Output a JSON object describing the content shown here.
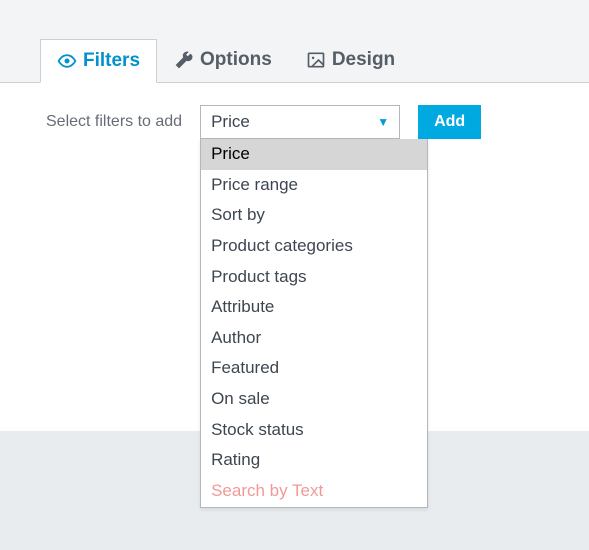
{
  "tabs": {
    "filters": {
      "label": "Filters",
      "icon": "eye-icon"
    },
    "options": {
      "label": "Options",
      "icon": "wrench-icon"
    },
    "design": {
      "label": "Design",
      "icon": "image-icon"
    },
    "active": "filters"
  },
  "filters_panel": {
    "select_label": "Select filters to add",
    "selected": "Price",
    "options": [
      {
        "label": "Price",
        "highlighted": true
      },
      {
        "label": "Price range"
      },
      {
        "label": "Sort by"
      },
      {
        "label": "Product categories"
      },
      {
        "label": "Product tags"
      },
      {
        "label": "Attribute"
      },
      {
        "label": "Author"
      },
      {
        "label": "Featured"
      },
      {
        "label": "On sale"
      },
      {
        "label": "Stock status"
      },
      {
        "label": "Rating"
      },
      {
        "label": "Search by Text",
        "disabled": true
      }
    ],
    "add_button": "Add"
  },
  "colors": {
    "accent": "#00a9e0",
    "tab_active": "#0391cd",
    "disabled_text": "#f09a98"
  }
}
